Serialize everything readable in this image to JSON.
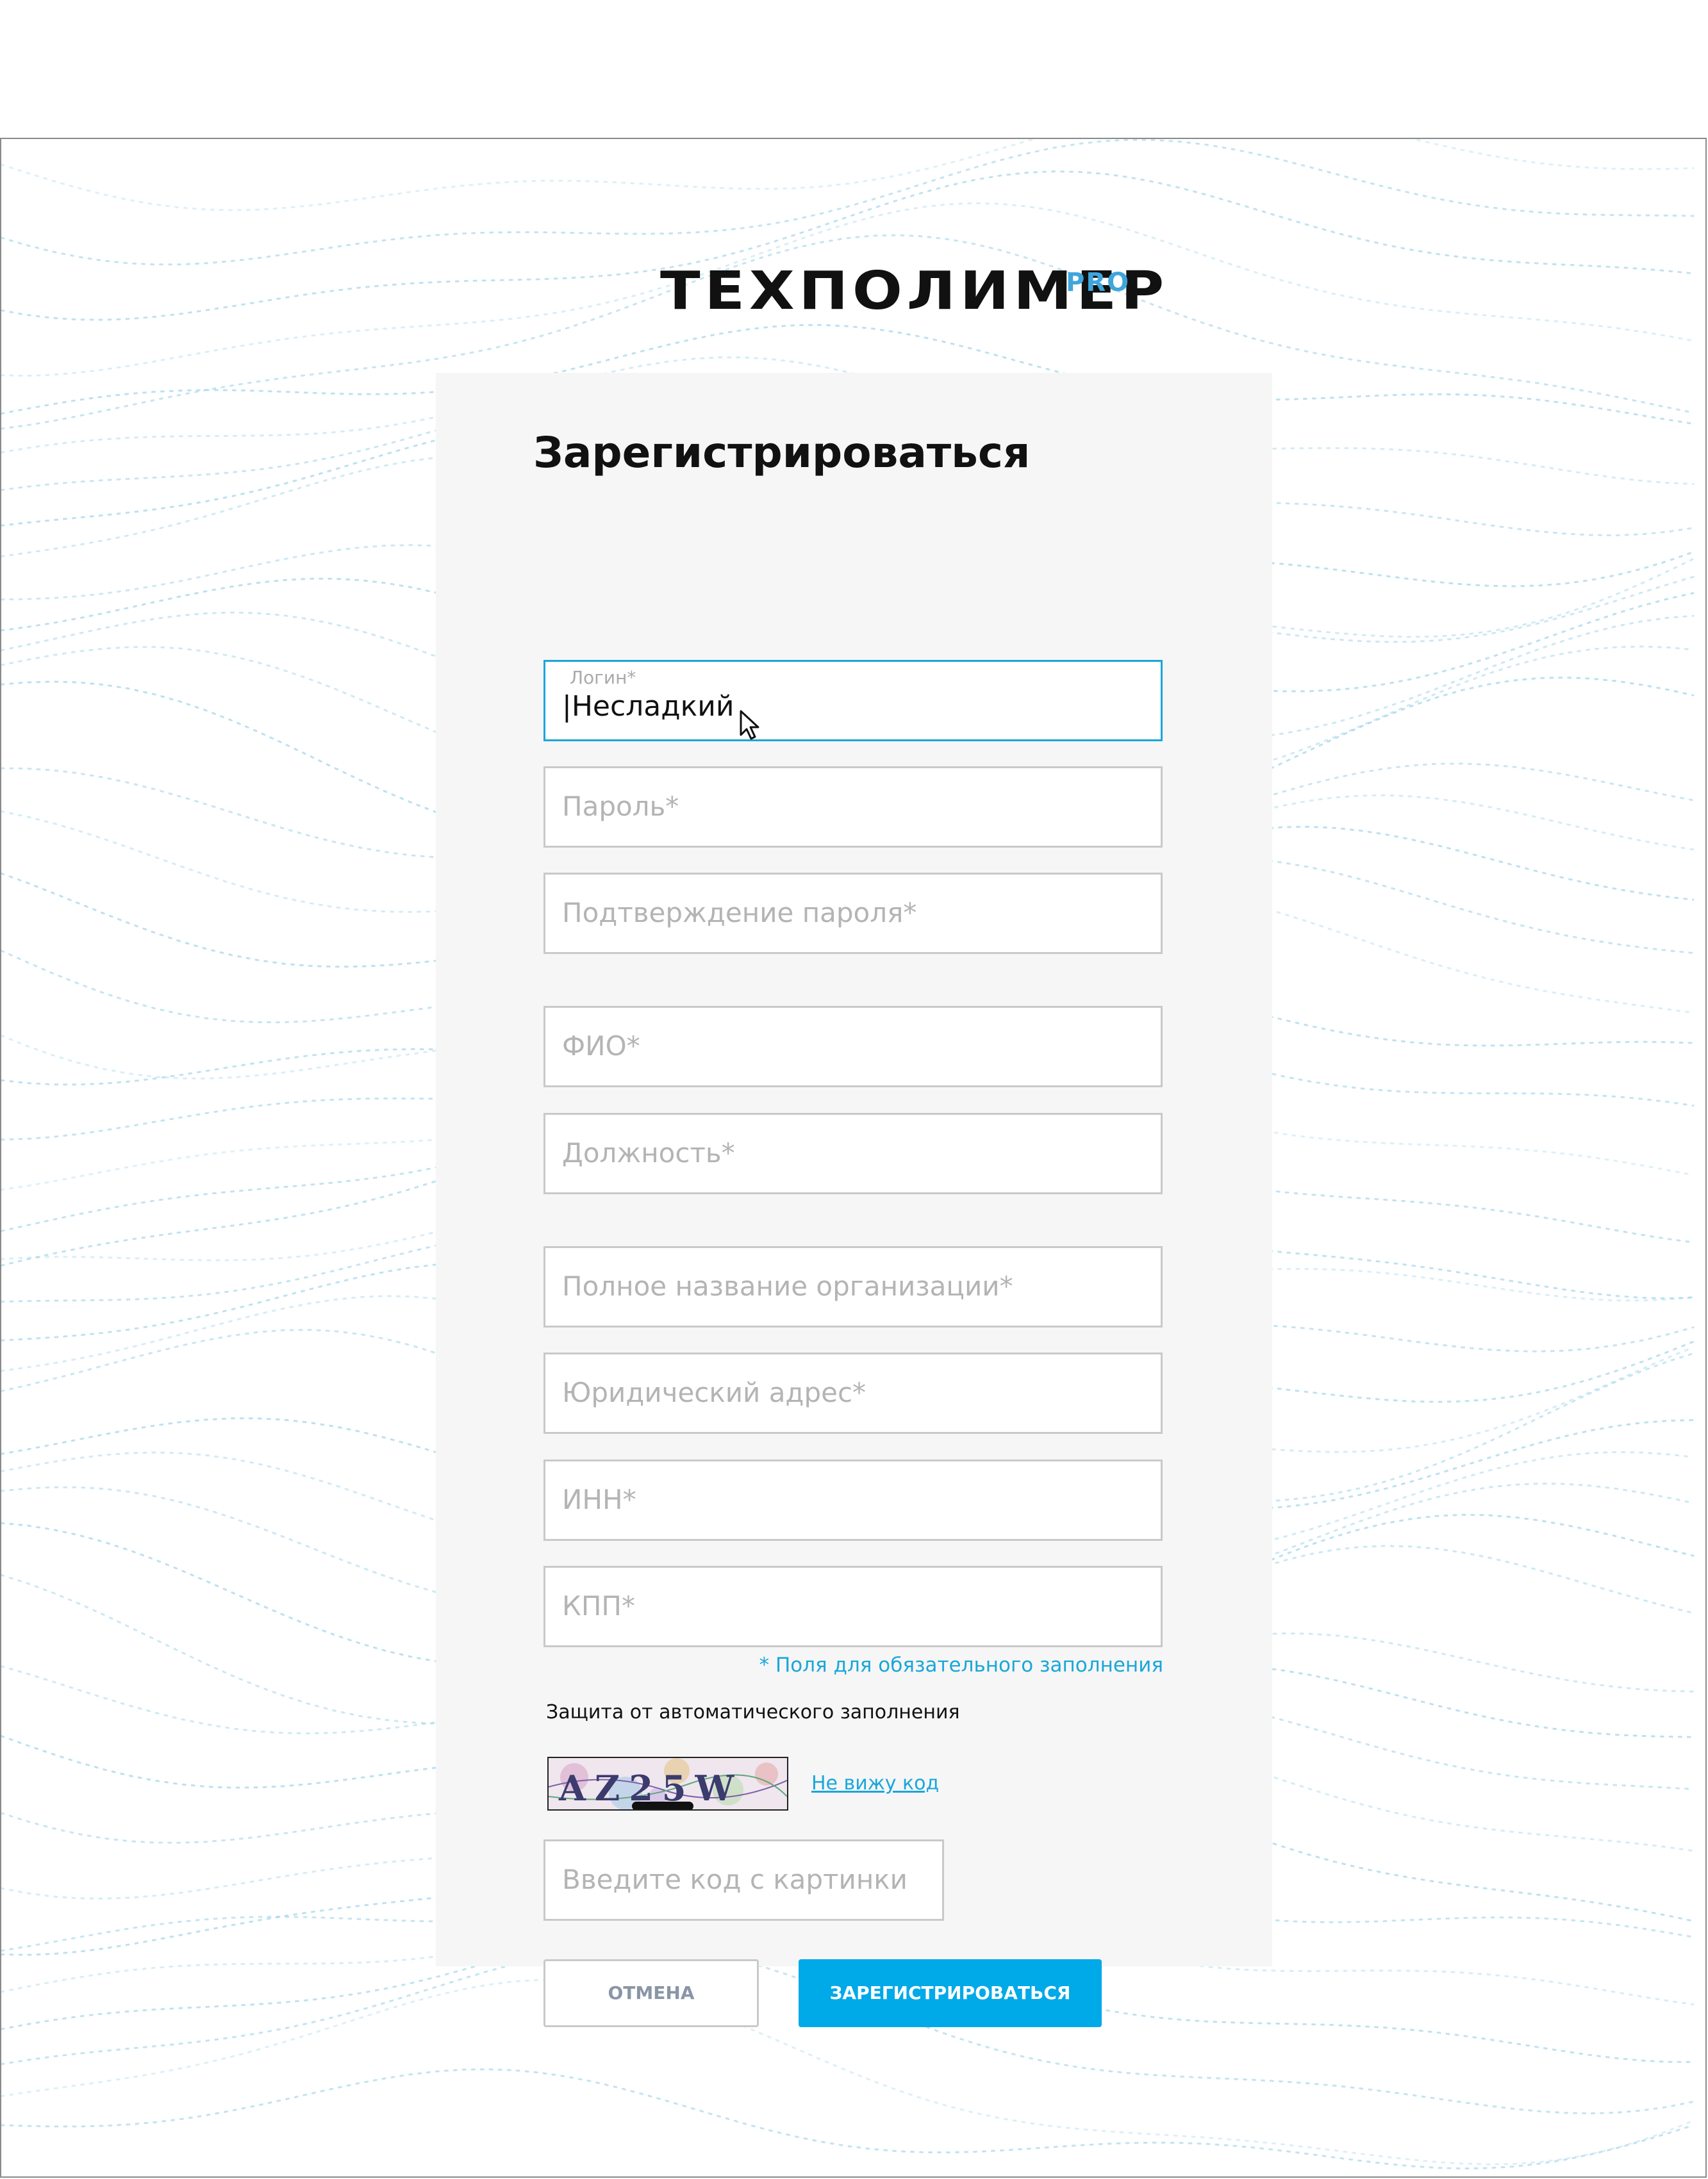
{
  "logo": {
    "main": "ТЕХПОЛИМЕР",
    "suffix": "PRO"
  },
  "form": {
    "title": "Зарегистрироваться",
    "login": {
      "label": "Логин*",
      "value": "|Несладкий"
    },
    "password": {
      "placeholder": "Пароль*"
    },
    "password_confirm": {
      "placeholder": "Подтверждение пароля*"
    },
    "full_name": {
      "placeholder": "ФИО*"
    },
    "position": {
      "placeholder": " Должность*"
    },
    "organization": {
      "placeholder": "Полное название организации*"
    },
    "legal_address": {
      "placeholder": "Юридический адрес*"
    },
    "inn": {
      "placeholder": "ИНН*"
    },
    "kpp": {
      "placeholder": "КПП*"
    },
    "required_note": "* Поля для обязательного заполнения",
    "captcha": {
      "section_label": "Защита от автоматического заполнения",
      "image_text": "AZ25W",
      "cant_see_link": "Не вижу код",
      "input_placeholder": "Введите код с картинки"
    },
    "buttons": {
      "cancel": "ОТМЕНА",
      "register": "ЗАРЕГИСТРИРОВАТЬСЯ"
    }
  },
  "colors": {
    "accent": "#00a9e8",
    "logo_pro": "#3ea6dd",
    "card_bg": "#f6f6f6",
    "wave": "#9fd4ea"
  }
}
